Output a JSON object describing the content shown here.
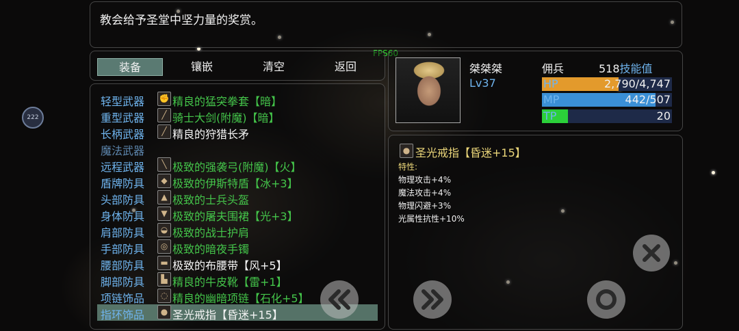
{
  "message": "教会给予圣堂中坚力量的奖赏。",
  "fps": "FPS60",
  "tabs": [
    {
      "label": "装备",
      "active": true
    },
    {
      "label": "镶嵌",
      "active": false
    },
    {
      "label": "清空",
      "active": false
    },
    {
      "label": "返回",
      "active": false
    }
  ],
  "equipment": [
    {
      "slot": "轻型武器",
      "item": "精良的猛突拳套【暗】",
      "color": "green",
      "icon": "gauntlet-icon"
    },
    {
      "slot": "重型武器",
      "item": "骑士大剑(附魔)【暗】",
      "color": "green",
      "icon": "sword-icon"
    },
    {
      "slot": "长柄武器",
      "item": "精良的狩猎长矛",
      "color": "white",
      "icon": "spear-icon"
    },
    {
      "slot": "魔法武器",
      "item": "",
      "color": "white",
      "icon": ""
    },
    {
      "slot": "远程武器",
      "item": "极致的强袭弓(附魔)【火】",
      "color": "green",
      "icon": "bow-icon"
    },
    {
      "slot": "盾牌防具",
      "item": "极致的伊斯特盾【冰+3】",
      "color": "green",
      "icon": "shield-icon"
    },
    {
      "slot": "头部防具",
      "item": "极致的士兵头盔",
      "color": "green",
      "icon": "helmet-icon"
    },
    {
      "slot": "身体防具",
      "item": "极致的屠夫围裙【光+3】",
      "color": "green",
      "icon": "apron-icon"
    },
    {
      "slot": "肩部防具",
      "item": "极致的战士护肩",
      "color": "green",
      "icon": "pauldron-icon"
    },
    {
      "slot": "手部防具",
      "item": "极致的暗夜手镯",
      "color": "green",
      "icon": "bracelet-icon"
    },
    {
      "slot": "腰部防具",
      "item": "极致的布腰带【风+5】",
      "color": "white",
      "icon": "belt-icon"
    },
    {
      "slot": "脚部防具",
      "item": "精良的牛皮靴【雷+1】",
      "color": "green",
      "icon": "boots-icon"
    },
    {
      "slot": "项链饰品",
      "item": "精良的幽暗项链【石化+5】",
      "color": "green",
      "icon": "necklace-icon"
    },
    {
      "slot": "指环饰品",
      "item": "圣光戒指【昏迷+15】",
      "color": "white",
      "icon": "ring-icon",
      "selected": true
    }
  ],
  "character": {
    "name": "桀桀桀",
    "level": "Lv37",
    "class": "佣兵",
    "skill_points": "518",
    "skill_label": "技能值",
    "hp": {
      "label": "HP",
      "value": "2,790/4,747",
      "ratio": 0.588,
      "color": "#e39a2c"
    },
    "mp": {
      "label": "MP",
      "value": "442/507",
      "ratio": 0.872,
      "color": "#3a8fd6"
    },
    "tp": {
      "label": "TP",
      "value": "20",
      "ratio": 0.2,
      "color": "#2bd03a"
    }
  },
  "detail": {
    "name": "圣光戒指【昏迷+15】",
    "features_label": "特性:",
    "stats": [
      "物理攻击+4%",
      "魔法攻击+4%",
      "物理闪避+3%",
      "光属性抗性+10%"
    ]
  },
  "side_badge": "222",
  "controls": [
    "page-prev-icon",
    "page-next-icon",
    "confirm-icon",
    "close-icon"
  ]
}
